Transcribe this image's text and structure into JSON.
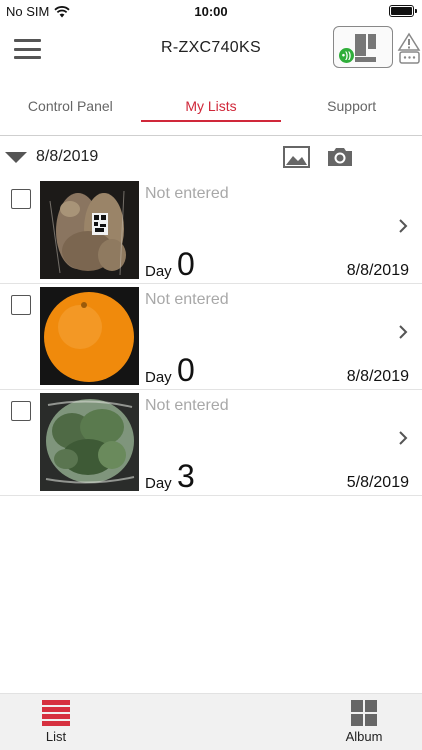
{
  "status_bar": {
    "carrier": "No SIM",
    "time": "10:00"
  },
  "header": {
    "title": "R-ZXC740KS",
    "connection_badge": "•))"
  },
  "tabs": [
    {
      "label": "Control Panel",
      "active": false
    },
    {
      "label": "My Lists",
      "active": true
    },
    {
      "label": "Support",
      "active": false
    }
  ],
  "date_group": {
    "date": "8/8/2019"
  },
  "items": [
    {
      "status": "Not entered",
      "day_label": "Day",
      "day": "0",
      "date": "8/8/2019",
      "checked": false,
      "photo": "potatoes-in-bag"
    },
    {
      "status": "Not entered",
      "day_label": "Day",
      "day": "0",
      "date": "8/8/2019",
      "checked": false,
      "photo": "orange"
    },
    {
      "status": "Not entered",
      "day_label": "Day",
      "day": "3",
      "date": "5/8/2019",
      "checked": false,
      "photo": "lettuce-in-bag"
    }
  ],
  "bottom_nav": [
    {
      "label": "List",
      "icon": "list-icon",
      "active": true
    },
    {
      "label": "Album",
      "icon": "grid-icon",
      "active": false
    }
  ],
  "colors": {
    "accent": "#d0283a",
    "connected": "#2fae3a",
    "muted_text": "#a8a8a8"
  }
}
